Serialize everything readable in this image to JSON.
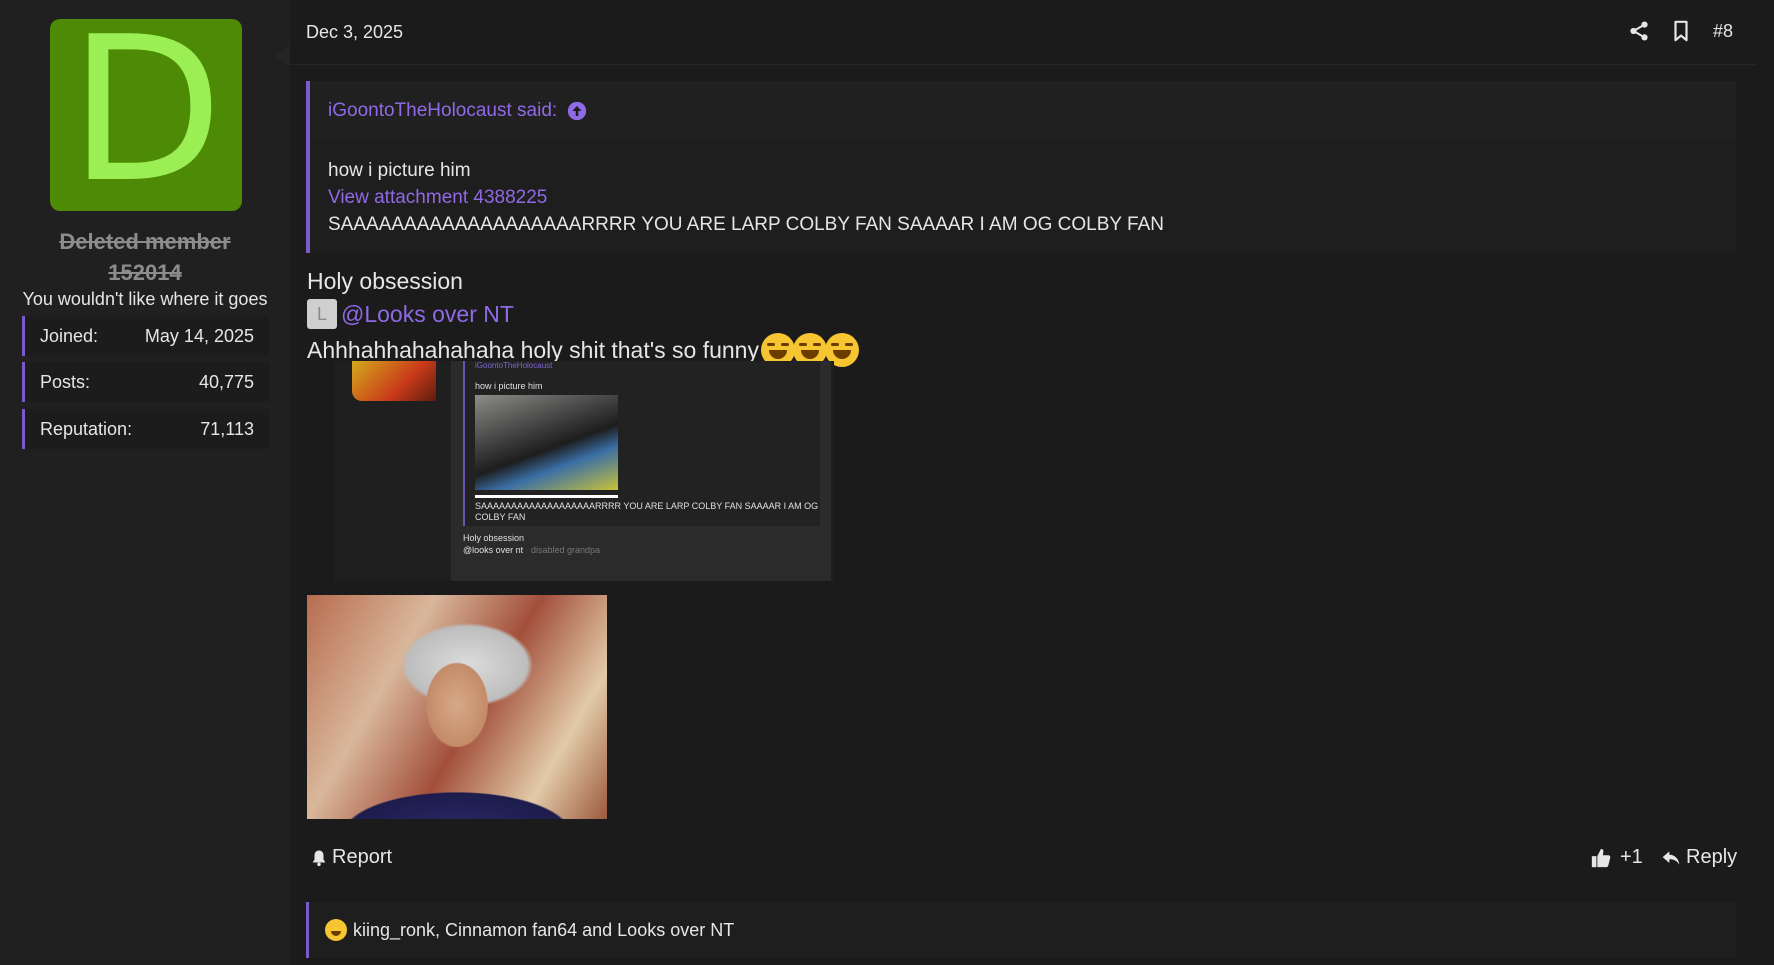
{
  "user": {
    "avatar_letter": "D",
    "avatar_color": "#4d8a05",
    "username_line1": "Deleted member",
    "username_line2": "152014",
    "title": "You wouldn't like where it goes",
    "stats": [
      {
        "label": "Joined:",
        "value": "May 14, 2025"
      },
      {
        "label": "Posts:",
        "value": "40,775"
      },
      {
        "label": "Reputation:",
        "value": "71,113"
      }
    ]
  },
  "post": {
    "date": "Dec 3, 2025",
    "number": "#8",
    "quote": {
      "author": "iGoontoTheHolocaust said:",
      "line1": "how i picture him",
      "link": "View attachment 4388225",
      "line2": "SAAAAAAAAAAAAAAAAAAARRRR YOU ARE LARP COLBY FAN SAAAAR I AM OG COLBY FAN"
    },
    "message_line1": "Holy obsession",
    "mention_avatar": "L",
    "mention": "@Looks over NT",
    "message_line3": "Ahhhahhahahahaha holy shit that's so funny",
    "embedded_screenshot": {
      "quote_author": "iGoontoTheHolocaust",
      "line1": "how i picture him",
      "line2": "SAAAAAAAAAAAAAAAAAAARRRR YOU ARE LARP COLBY FAN SAAAAR I AM OG",
      "line3": "COLBY FAN",
      "reply_line1": "Holy obsession",
      "reply_mention": "@looks over nt",
      "reply_suggestion": "disabled grandpa"
    },
    "footer": {
      "report": "Report",
      "like_count": "+1",
      "reply": "Reply"
    },
    "reactions_text": "kiing_ronk, Cinnamon fan64 and Looks over NT"
  },
  "accent": "#7b5bc9",
  "link_color": "#8f6ae6"
}
